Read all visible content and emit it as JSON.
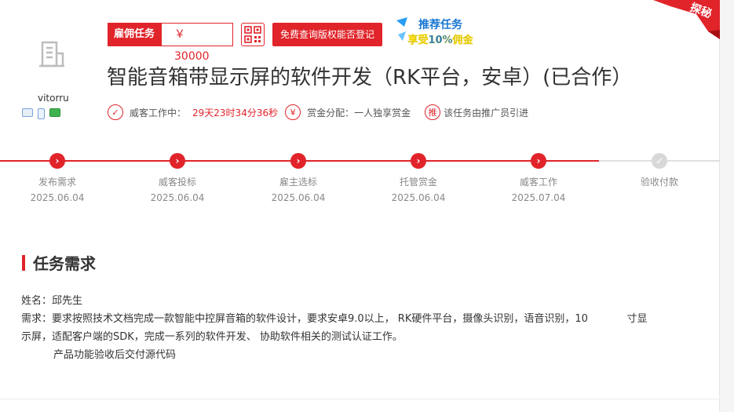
{
  "employer": {
    "username": "vitorru",
    "avatar_icon": "building-icon"
  },
  "task": {
    "type_label": "雇佣任务",
    "price": "￥ 30000",
    "check_button": "免费查询版权能否登记",
    "promo_line1": "推荐任务",
    "promo_line2": "享受10%佣金",
    "ribbon_text": "探秘",
    "title": "智能音箱带显示屏的软件开发（RK平台，安卓）(已合作）"
  },
  "meta": {
    "working_label": "威客工作中：",
    "countdown": "29天23时34分36秒",
    "reward_label": "赏金分配：一人独享赏金",
    "promoter_text": "该任务由推广员引进",
    "promoter_icon_char": "推",
    "reward_icon_char": "¥"
  },
  "steps": [
    {
      "label": "发布需求",
      "date": "2025.06.04",
      "done": true
    },
    {
      "label": "威客投标",
      "date": "2025.06.04",
      "done": true
    },
    {
      "label": "雇主选标",
      "date": "2025.06.04",
      "done": true
    },
    {
      "label": "托管赏金",
      "date": "2025.06.04",
      "done": true
    },
    {
      "label": "威客工作",
      "date": "2025.07.04",
      "done": true
    },
    {
      "label": "验收付款",
      "date": "",
      "done": false
    }
  ],
  "requirement": {
    "section_title": "任务需求",
    "name_line": "姓名：邱先生",
    "desc_line1": "需求：要求按照技术文档完成一款智能中控屏音箱的软件设计，要求安卓9.0以上， RK硬件平台，摄像头识别，语音识别，10            寸显",
    "desc_line2": "示屏，适配客户端的SDK，完成一系列的软件开发、 协助软件相关的测试认证工作。",
    "desc_line3": "产品功能验收后交付源代码"
  },
  "colors": {
    "accent": "#e0242a",
    "inactive": "#d8d8d8"
  }
}
